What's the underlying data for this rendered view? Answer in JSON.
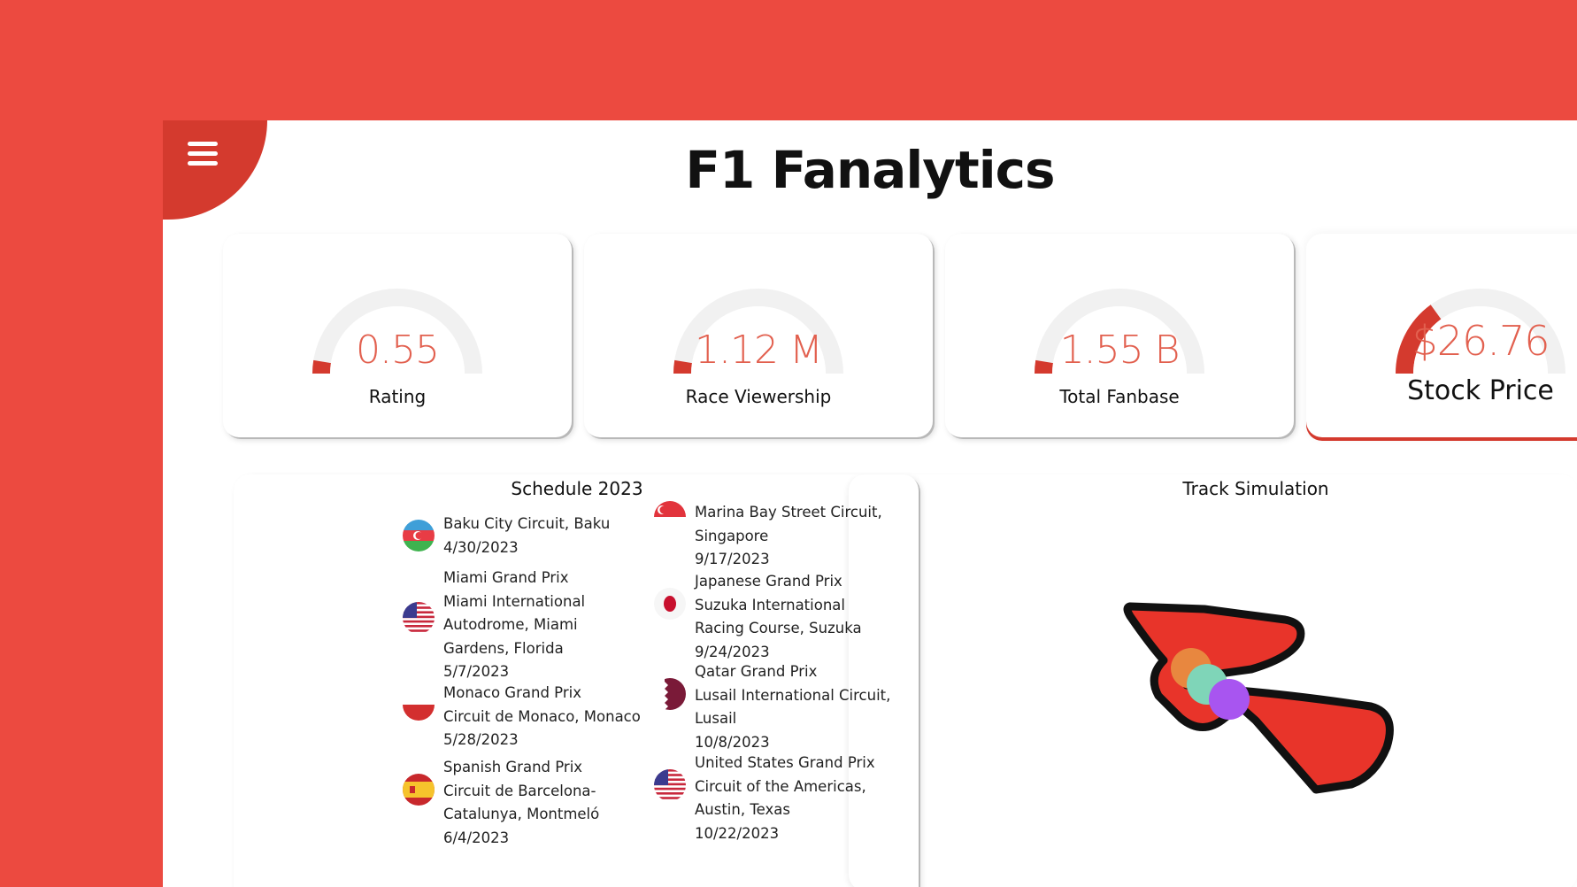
{
  "header": {
    "title": "F1 Fanalytics",
    "menu_icon": "hamburger-menu-icon"
  },
  "stats": [
    {
      "value": "0.55",
      "label": "Rating",
      "level": 0.05
    },
    {
      "value": "1.12 M",
      "label": "Race Viewership",
      "level": 0.05
    },
    {
      "value": "1.55 B",
      "label": "Total Fanbase",
      "level": 0.05
    },
    {
      "value": "$26.76",
      "label": "Stock Price",
      "level": 0.3,
      "active": true
    }
  ],
  "schedule": {
    "title": "Schedule 2023",
    "races": [
      {
        "name": "",
        "circuit": "Baku City Circuit, Baku",
        "date": "4/30/2023",
        "flag": "azerbaijan-flag-icon"
      },
      {
        "name": "Miami Grand Prix",
        "circuit": "Miami International Autodrome, Miami Gardens, Florida",
        "date": "5/7/2023",
        "flag": "usa-flag-icon"
      },
      {
        "name": "Monaco Grand Prix",
        "circuit": "Circuit de Monaco, Monaco",
        "date": "5/28/2023",
        "flag": "monaco-flag-icon"
      },
      {
        "name": "Spanish Grand Prix",
        "circuit": "Circuit de Barcelona-Catalunya, Montmeló",
        "date": "6/4/2023",
        "flag": "spain-flag-icon"
      },
      {
        "name": "",
        "circuit": "Marina Bay Street Circuit, Singapore",
        "date": "9/17/2023",
        "flag": "singapore-flag-icon"
      },
      {
        "name": "Japanese Grand Prix",
        "circuit": "Suzuka International Racing Course, Suzuka",
        "date": "9/24/2023",
        "flag": "japan-flag-icon"
      },
      {
        "name": "Qatar Grand Prix",
        "circuit": "Lusail International Circuit, Lusail",
        "date": "10/8/2023",
        "flag": "qatar-flag-icon"
      },
      {
        "name": "United States Grand Prix",
        "circuit": "Circuit of the Americas, Austin, Texas",
        "date": "10/22/2023",
        "flag": "usa-flag-icon"
      }
    ]
  },
  "track": {
    "title": "Track Simulation",
    "track_color": "#e8342a",
    "outline_color": "#111111",
    "cars": [
      {
        "color": "#e8873f"
      },
      {
        "color": "#7fd5b8"
      },
      {
        "color": "#a855f0"
      }
    ]
  },
  "colors": {
    "background": "#ec4a40",
    "accent": "#d43a2e",
    "value_text": "#e2604f"
  }
}
